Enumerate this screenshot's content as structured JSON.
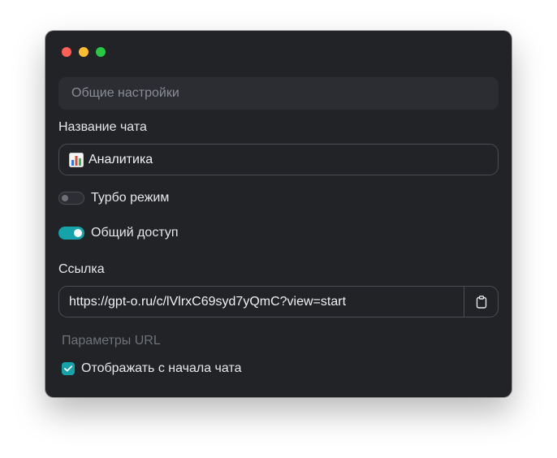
{
  "window": {
    "controls": [
      "close",
      "minimize",
      "maximize"
    ]
  },
  "section": {
    "title": "Общие настройки"
  },
  "chat_name": {
    "label": "Название чата",
    "value": "Аналитика",
    "icon": "bar-chart-icon"
  },
  "turbo": {
    "label": "Турбо режим",
    "enabled": false
  },
  "shared": {
    "label": "Общий доступ",
    "enabled": true
  },
  "link": {
    "label": "Ссылка",
    "value": "https://gpt-o.ru/c/lVlrxC69syd7yQmC?view=start",
    "copy_icon": "clipboard-icon"
  },
  "url_params": {
    "label": "Параметры URL",
    "show_from_start": {
      "label": "Отображать с начала чата",
      "checked": true
    }
  },
  "colors": {
    "accent": "#14a3a8",
    "background": "#212327",
    "border": "#4a4d54"
  }
}
